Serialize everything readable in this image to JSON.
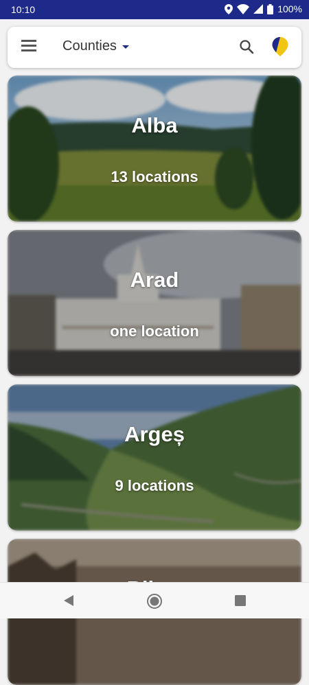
{
  "status_bar": {
    "time": "10:10",
    "battery": "100%",
    "icons": [
      "location-icon",
      "wifi-icon",
      "signal-icon",
      "battery-icon"
    ],
    "color": "#1d2a8a"
  },
  "app_bar": {
    "menu_icon": "hamburger-menu-icon",
    "title": "Counties",
    "dropdown_icon": "caret-down-icon",
    "search_icon": "search-icon",
    "logo_icon": "app-logo-icon",
    "accent_color": "#1d2a8a",
    "logo_color": "#f2c413"
  },
  "counties": [
    {
      "name": "Alba",
      "locations": "13 locations"
    },
    {
      "name": "Arad",
      "locations": "one location"
    },
    {
      "name": "Argeș",
      "locations": "9 locations"
    },
    {
      "name": "Bihor",
      "locations": ""
    }
  ],
  "nav_bar": {
    "icons": [
      "back-icon",
      "home-icon",
      "recents-icon"
    ]
  }
}
